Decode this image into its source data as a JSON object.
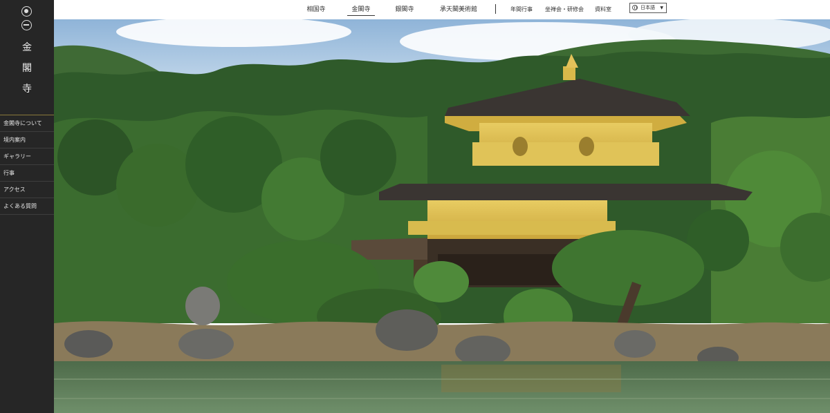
{
  "sidebar": {
    "brand": [
      "金",
      "閣",
      "寺"
    ],
    "nav": [
      {
        "label": "金閣寺について"
      },
      {
        "label": "境内案内"
      },
      {
        "label": "ギャラリー"
      },
      {
        "label": "行事"
      },
      {
        "label": "アクセス"
      },
      {
        "label": "よくある質問"
      }
    ]
  },
  "topbar": {
    "tabs": [
      {
        "label": "相国寺"
      },
      {
        "label": "金閣寺"
      },
      {
        "label": "銀閣寺"
      },
      {
        "label": "承天閣美術館"
      }
    ],
    "links": [
      {
        "label": "年間行事"
      },
      {
        "label": "坐禅会・研修会"
      },
      {
        "label": "資料室"
      }
    ],
    "language": {
      "label": "日本語",
      "caret": "▼"
    }
  },
  "colors": {
    "sidebar_bg": "#262626",
    "accent_rule": "#8a7a3a",
    "gold": "#d9b94a"
  }
}
